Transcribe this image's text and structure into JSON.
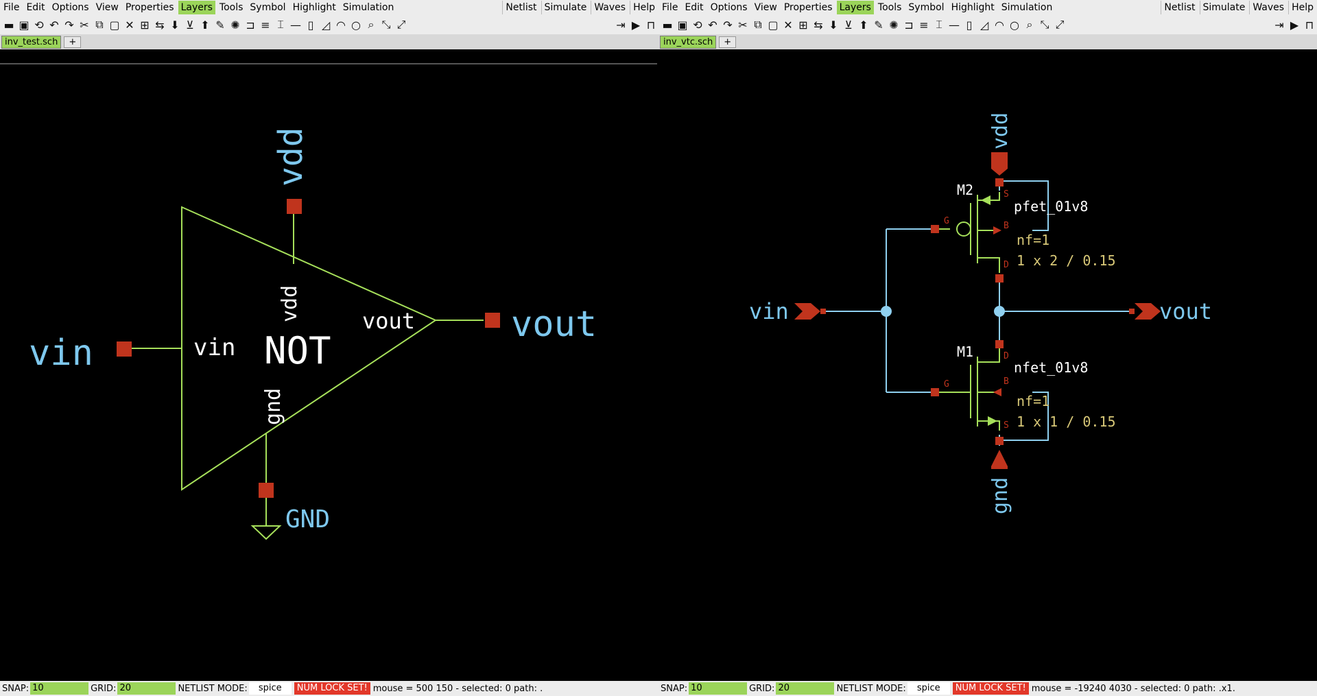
{
  "left": {
    "menu": [
      "File",
      "Edit",
      "Options",
      "View",
      "Properties",
      "Layers",
      "Tools",
      "Symbol",
      "Highlight",
      "Simulation"
    ],
    "menu_right": [
      "Netlist",
      "Simulate",
      "Waves",
      "Help"
    ],
    "tab": "inv_test.sch",
    "tab_add": "+",
    "status": {
      "snap_label": "SNAP:",
      "snap": "10",
      "grid_label": "GRID:",
      "grid": "20",
      "netlist_label": "NETLIST MODE:",
      "netlist": "spice",
      "numlock": "NUM LOCK SET!",
      "mouse": "mouse = 500 150 - selected: 0 path: ."
    },
    "schematic": {
      "vin": "vin",
      "vout": "vout",
      "vdd": "vdd",
      "gnd_label": "GND",
      "pin_vin": "vin",
      "pin_vout": "vout",
      "pin_vdd": "vdd",
      "pin_gnd": "gnd",
      "cell": "NOT"
    }
  },
  "right": {
    "menu": [
      "File",
      "Edit",
      "Options",
      "View",
      "Properties",
      "Layers",
      "Tools",
      "Symbol",
      "Highlight",
      "Simulation"
    ],
    "menu_right": [
      "Netlist",
      "Simulate",
      "Waves",
      "Help"
    ],
    "tab": "inv_vtc.sch",
    "tab_add": "+",
    "status": {
      "snap_label": "SNAP:",
      "snap": "10",
      "grid_label": "GRID:",
      "grid": "20",
      "netlist_label": "NETLIST MODE:",
      "netlist": "spice",
      "numlock": "NUM LOCK SET!",
      "mouse": "mouse = -19240 4030 - selected: 0 path: .x1."
    },
    "schematic": {
      "vin": "vin",
      "vout": "vout",
      "vdd": "vdd",
      "gnd": "gnd",
      "m2_name": "M2",
      "m2_model": "pfet_01v8",
      "m2_nf": "nf=1",
      "m2_size": "1 x 2 / 0.15",
      "m1_name": "M1",
      "m1_model": "nfet_01v8",
      "m1_nf": "nf=1",
      "m1_size": "1 x 1 / 0.15",
      "pin_g": "G",
      "pin_s": "S",
      "pin_d": "D",
      "pin_b": "B"
    }
  },
  "colors": {
    "wire": "#8fd0f0",
    "symbol": "#a6e05a",
    "pin": "#c0341d",
    "label": "#7ec8ee",
    "white": "#ffffff",
    "attr": "#d8c878",
    "active": "#9bd45a",
    "numlock": "#e2382a"
  },
  "toolbar_icons": [
    "folder-icon",
    "save-icon",
    "reload-icon",
    "undo-icon",
    "redo-icon",
    "cut-icon",
    "copy-icon",
    "paste-icon",
    "delete-icon",
    "open-sym-icon",
    "swap-icon",
    "push-icon",
    "pop-icon",
    "up-icon",
    "pen-icon",
    "highlight-icon",
    "wire-icon",
    "pin-icon",
    "line-icon",
    "rect-icon",
    "poly-icon",
    "arc-icon",
    "circle-icon",
    "zoom-icon",
    "zoom-fit-icon",
    "netlist-icon",
    "run-icon",
    "waves-icon"
  ]
}
